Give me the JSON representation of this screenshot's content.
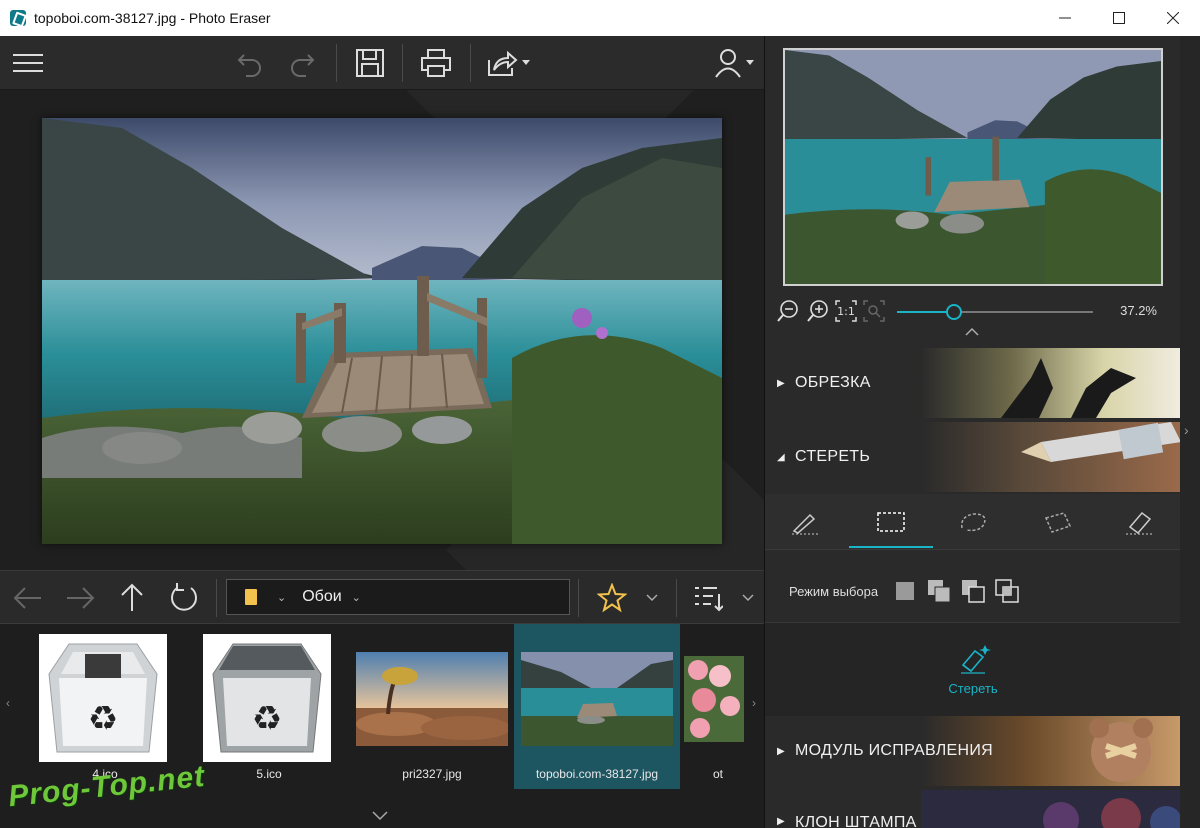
{
  "window": {
    "title": "topoboi.com-38127.jpg - Photo Eraser",
    "controls": [
      "minimize",
      "maximize",
      "close"
    ]
  },
  "toolbar": {
    "icons": [
      "menu-icon",
      "undo-icon",
      "redo-icon",
      "save-icon",
      "print-icon",
      "share-icon",
      "user-icon"
    ]
  },
  "navigator": {
    "folder": "Обои"
  },
  "thumbnails": [
    {
      "label": "4.ico",
      "kind": "recycle-bin-empty"
    },
    {
      "label": "5.ico",
      "kind": "recycle-bin-full"
    },
    {
      "label": "pri2327.jpg",
      "kind": "desert-tree"
    },
    {
      "label": "topoboi.com-38127.jpg",
      "kind": "lake-pier",
      "active": true
    },
    {
      "label": "ot",
      "kind": "flowers"
    }
  ],
  "watermark": "Prog-Top.net",
  "zoom": {
    "value_label": "37.2%",
    "value": 0.372
  },
  "sections": {
    "crop": "ОБРЕЗКА",
    "erase": "СТЕРЕТЬ",
    "repair": "МОДУЛЬ ИСПРАВЛЕНИЯ",
    "clone": "КЛОН ШТАМПА"
  },
  "erase_panel": {
    "mode_label": "Режим выбора",
    "erase_button": "Стереть"
  },
  "colors": {
    "accent": "#19b4c8",
    "active_thumb": "#1d5561",
    "watermark": "#6ec83a"
  }
}
